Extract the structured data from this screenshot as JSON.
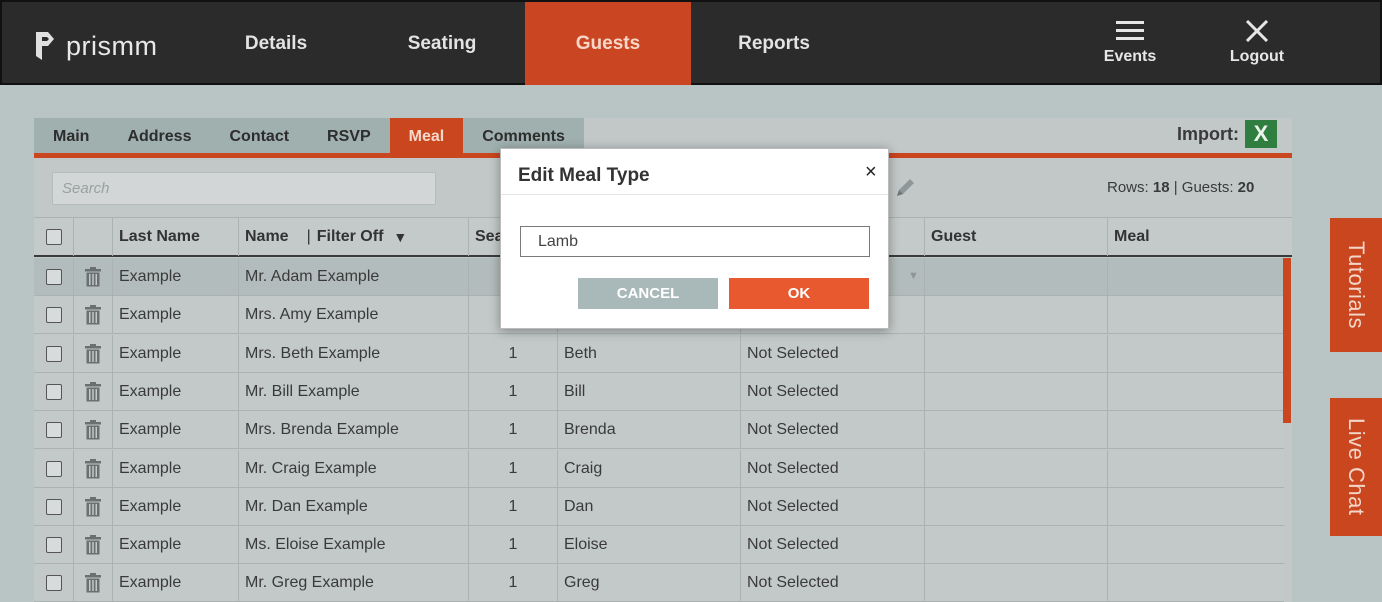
{
  "header": {
    "logo_text": "prismm",
    "nav": [
      {
        "label": "Details"
      },
      {
        "label": "Seating"
      },
      {
        "label": "Guests"
      },
      {
        "label": "Reports"
      }
    ],
    "events_label": "Events",
    "logout_label": "Logout",
    "active_color": "#ca4622"
  },
  "subtabs": [
    "Main",
    "Address",
    "Contact",
    "RSVP",
    "Meal",
    "Comments"
  ],
  "active_subtab": "Meal",
  "import_label": "Import:",
  "import_icon": "excel-icon",
  "search": {
    "placeholder": "Search"
  },
  "rows_info": {
    "rows_label": "Rows:",
    "rows": "18",
    "guests_label": "Guests:",
    "guests": "20"
  },
  "table": {
    "headers": {
      "last_name": "Last Name",
      "name": "Name",
      "filter": "Filter Off",
      "seat": "Sea",
      "guest": "Guest",
      "meal": "Meal"
    },
    "rows": [
      {
        "last": "Example",
        "name": "Mr. Adam Example",
        "seat": "",
        "first": "",
        "meal": ""
      },
      {
        "last": "Example",
        "name": "Mrs. Amy Example",
        "seat": "",
        "first": "",
        "meal": ""
      },
      {
        "last": "Example",
        "name": "Mrs. Beth Example",
        "seat": "1",
        "first": "Beth",
        "meal": "Not Selected"
      },
      {
        "last": "Example",
        "name": "Mr. Bill Example",
        "seat": "1",
        "first": "Bill",
        "meal": "Not Selected"
      },
      {
        "last": "Example",
        "name": "Mrs. Brenda Example",
        "seat": "1",
        "first": "Brenda",
        "meal": "Not Selected"
      },
      {
        "last": "Example",
        "name": "Mr. Craig Example",
        "seat": "1",
        "first": "Craig",
        "meal": "Not Selected"
      },
      {
        "last": "Example",
        "name": "Mr. Dan Example",
        "seat": "1",
        "first": "Dan",
        "meal": "Not Selected"
      },
      {
        "last": "Example",
        "name": "Ms. Eloise Example",
        "seat": "1",
        "first": "Eloise",
        "meal": "Not Selected"
      },
      {
        "last": "Example",
        "name": "Mr. Greg Example",
        "seat": "1",
        "first": "Greg",
        "meal": "Not Selected"
      }
    ]
  },
  "side_tabs": {
    "tutorials": "Tutorials",
    "live_chat": "Live Chat"
  },
  "modal": {
    "title": "Edit Meal Type",
    "close": "×",
    "input_value": "Lamb",
    "cancel": "CANCEL",
    "ok": "OK"
  }
}
